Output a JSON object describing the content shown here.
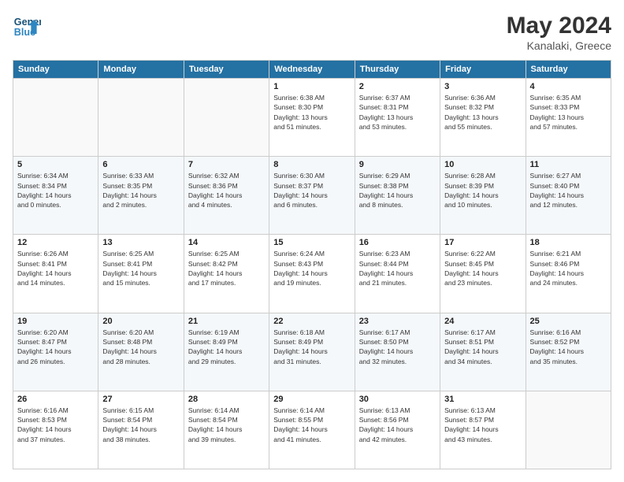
{
  "header": {
    "logo_line1": "General",
    "logo_line2": "Blue",
    "month": "May 2024",
    "location": "Kanalaki, Greece"
  },
  "weekdays": [
    "Sunday",
    "Monday",
    "Tuesday",
    "Wednesday",
    "Thursday",
    "Friday",
    "Saturday"
  ],
  "rows": [
    [
      {
        "day": "",
        "info": ""
      },
      {
        "day": "",
        "info": ""
      },
      {
        "day": "",
        "info": ""
      },
      {
        "day": "1",
        "info": "Sunrise: 6:38 AM\nSunset: 8:30 PM\nDaylight: 13 hours\nand 51 minutes."
      },
      {
        "day": "2",
        "info": "Sunrise: 6:37 AM\nSunset: 8:31 PM\nDaylight: 13 hours\nand 53 minutes."
      },
      {
        "day": "3",
        "info": "Sunrise: 6:36 AM\nSunset: 8:32 PM\nDaylight: 13 hours\nand 55 minutes."
      },
      {
        "day": "4",
        "info": "Sunrise: 6:35 AM\nSunset: 8:33 PM\nDaylight: 13 hours\nand 57 minutes."
      }
    ],
    [
      {
        "day": "5",
        "info": "Sunrise: 6:34 AM\nSunset: 8:34 PM\nDaylight: 14 hours\nand 0 minutes."
      },
      {
        "day": "6",
        "info": "Sunrise: 6:33 AM\nSunset: 8:35 PM\nDaylight: 14 hours\nand 2 minutes."
      },
      {
        "day": "7",
        "info": "Sunrise: 6:32 AM\nSunset: 8:36 PM\nDaylight: 14 hours\nand 4 minutes."
      },
      {
        "day": "8",
        "info": "Sunrise: 6:30 AM\nSunset: 8:37 PM\nDaylight: 14 hours\nand 6 minutes."
      },
      {
        "day": "9",
        "info": "Sunrise: 6:29 AM\nSunset: 8:38 PM\nDaylight: 14 hours\nand 8 minutes."
      },
      {
        "day": "10",
        "info": "Sunrise: 6:28 AM\nSunset: 8:39 PM\nDaylight: 14 hours\nand 10 minutes."
      },
      {
        "day": "11",
        "info": "Sunrise: 6:27 AM\nSunset: 8:40 PM\nDaylight: 14 hours\nand 12 minutes."
      }
    ],
    [
      {
        "day": "12",
        "info": "Sunrise: 6:26 AM\nSunset: 8:41 PM\nDaylight: 14 hours\nand 14 minutes."
      },
      {
        "day": "13",
        "info": "Sunrise: 6:25 AM\nSunset: 8:41 PM\nDaylight: 14 hours\nand 15 minutes."
      },
      {
        "day": "14",
        "info": "Sunrise: 6:25 AM\nSunset: 8:42 PM\nDaylight: 14 hours\nand 17 minutes."
      },
      {
        "day": "15",
        "info": "Sunrise: 6:24 AM\nSunset: 8:43 PM\nDaylight: 14 hours\nand 19 minutes."
      },
      {
        "day": "16",
        "info": "Sunrise: 6:23 AM\nSunset: 8:44 PM\nDaylight: 14 hours\nand 21 minutes."
      },
      {
        "day": "17",
        "info": "Sunrise: 6:22 AM\nSunset: 8:45 PM\nDaylight: 14 hours\nand 23 minutes."
      },
      {
        "day": "18",
        "info": "Sunrise: 6:21 AM\nSunset: 8:46 PM\nDaylight: 14 hours\nand 24 minutes."
      }
    ],
    [
      {
        "day": "19",
        "info": "Sunrise: 6:20 AM\nSunset: 8:47 PM\nDaylight: 14 hours\nand 26 minutes."
      },
      {
        "day": "20",
        "info": "Sunrise: 6:20 AM\nSunset: 8:48 PM\nDaylight: 14 hours\nand 28 minutes."
      },
      {
        "day": "21",
        "info": "Sunrise: 6:19 AM\nSunset: 8:49 PM\nDaylight: 14 hours\nand 29 minutes."
      },
      {
        "day": "22",
        "info": "Sunrise: 6:18 AM\nSunset: 8:49 PM\nDaylight: 14 hours\nand 31 minutes."
      },
      {
        "day": "23",
        "info": "Sunrise: 6:17 AM\nSunset: 8:50 PM\nDaylight: 14 hours\nand 32 minutes."
      },
      {
        "day": "24",
        "info": "Sunrise: 6:17 AM\nSunset: 8:51 PM\nDaylight: 14 hours\nand 34 minutes."
      },
      {
        "day": "25",
        "info": "Sunrise: 6:16 AM\nSunset: 8:52 PM\nDaylight: 14 hours\nand 35 minutes."
      }
    ],
    [
      {
        "day": "26",
        "info": "Sunrise: 6:16 AM\nSunset: 8:53 PM\nDaylight: 14 hours\nand 37 minutes."
      },
      {
        "day": "27",
        "info": "Sunrise: 6:15 AM\nSunset: 8:54 PM\nDaylight: 14 hours\nand 38 minutes."
      },
      {
        "day": "28",
        "info": "Sunrise: 6:14 AM\nSunset: 8:54 PM\nDaylight: 14 hours\nand 39 minutes."
      },
      {
        "day": "29",
        "info": "Sunrise: 6:14 AM\nSunset: 8:55 PM\nDaylight: 14 hours\nand 41 minutes."
      },
      {
        "day": "30",
        "info": "Sunrise: 6:13 AM\nSunset: 8:56 PM\nDaylight: 14 hours\nand 42 minutes."
      },
      {
        "day": "31",
        "info": "Sunrise: 6:13 AM\nSunset: 8:57 PM\nDaylight: 14 hours\nand 43 minutes."
      },
      {
        "day": "",
        "info": ""
      }
    ]
  ]
}
